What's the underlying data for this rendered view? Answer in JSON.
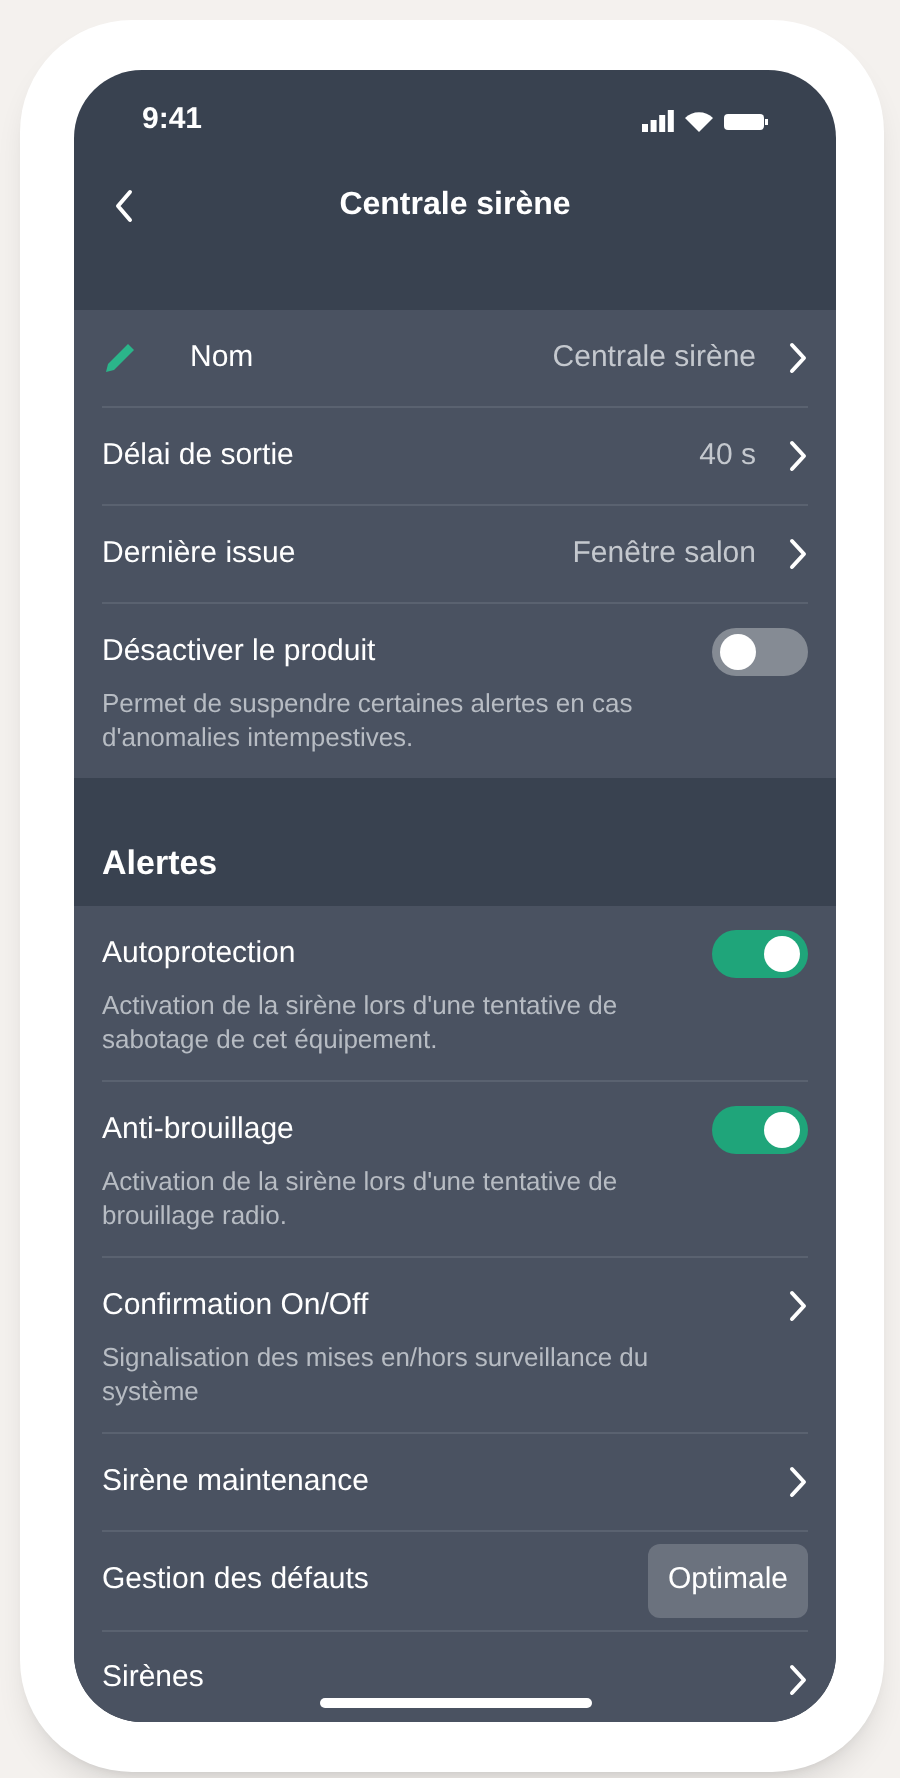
{
  "status_bar": {
    "time": "9:41"
  },
  "header": {
    "title": "Centrale sirène"
  },
  "groups": [
    {
      "rows": [
        {
          "kind": "edit",
          "label": "Nom",
          "value": "Centrale sirène"
        },
        {
          "kind": "nav",
          "label": "Délai de sortie",
          "value": "40 s"
        },
        {
          "kind": "nav",
          "label": "Dernière issue",
          "value": "Fenêtre salon"
        },
        {
          "kind": "toggle",
          "label": "Désactiver le produit",
          "on": false,
          "description": "Permet de suspendre certaines alertes en cas d'anomalies intempestives."
        }
      ]
    },
    {
      "heading": "Alertes",
      "rows": [
        {
          "kind": "toggle",
          "label": "Autoprotection",
          "on": true,
          "description": "Activation de la sirène lors d'une tentative de sabotage de cet équipement."
        },
        {
          "kind": "toggle",
          "label": "Anti-brouillage",
          "on": true,
          "description": "Activation de la sirène lors d'une tentative de brouillage radio."
        },
        {
          "kind": "nav",
          "label": "Confirmation On/Off",
          "description": "Signalisation des mises en/hors surveillance du système"
        },
        {
          "kind": "nav",
          "label": "Sirène maintenance"
        },
        {
          "kind": "button",
          "label": "Gestion des défauts",
          "button": "Optimale"
        },
        {
          "kind": "nav",
          "label": "Sirènes"
        }
      ]
    }
  ]
}
